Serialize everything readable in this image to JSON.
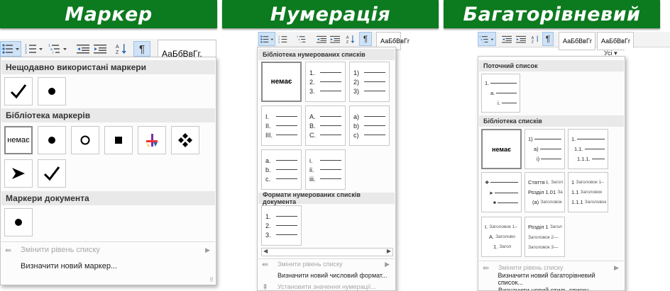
{
  "headers": {
    "marker": "Маркер",
    "numbering": "Нумерація",
    "multilevel": "Багаторівневий"
  },
  "ribbon": {
    "style_sample": "АаБбВвГг,",
    "style_sample_small": "АаБбВвГг",
    "pilcrow": "¶",
    "sort": "A↓Z",
    "all_label": "Усі ▾"
  },
  "bullets": {
    "recent_title": "Нещодавно використані маркери",
    "library_title": "Бібліотека маркерів",
    "document_title": "Маркери документа",
    "none_label": "немає",
    "change_level": "Змінити рівень списку",
    "define_new": "Визначити новий маркер..."
  },
  "numbering": {
    "library_title": "Бібліотека нумерованих списків",
    "document_title": "Формати нумерованих списків документа",
    "none_label": "немає",
    "sets": [
      [
        "1.",
        "2.",
        "3."
      ],
      [
        "1)",
        "2)",
        "3)"
      ],
      [
        "I.",
        "II.",
        "III."
      ],
      [
        "A.",
        "B.",
        "C."
      ],
      [
        "a)",
        "b)",
        "c)"
      ],
      [
        "a.",
        "b.",
        "c."
      ],
      [
        "i.",
        "ii.",
        "iii."
      ]
    ],
    "doc_set": [
      "1.",
      "2.",
      "3."
    ],
    "change_level": "Змінити рівень списку",
    "define_new": "Визначити новий числовий формат...",
    "set_value": "Установити значення нумерації..."
  },
  "multilevel": {
    "current_title": "Поточний список",
    "library_title": "Бібліотека списків",
    "none_label": "немає",
    "current": [
      "1.",
      "a.",
      "i."
    ],
    "lib1": [
      "1)",
      "a)",
      "i)"
    ],
    "lib2": [
      "1.",
      "1.1.",
      "1.1.1."
    ],
    "lib4a": "Стаття I.",
    "lib4a_g": "Загол",
    "lib4b": "Розділ 1.01",
    "lib4b_g": "За",
    "lib4c": "(a)",
    "lib4c_g": "Заголовок",
    "lib5a": "1",
    "lib5a_g": "Заголовок 1–",
    "lib5b": "1.1",
    "lib5b_g": "Заголовок",
    "lib5c": "1.1.1",
    "lib5c_g": "Заголовок",
    "lib6a": "I.",
    "lib6a_g": "Заголовок 1–",
    "lib6b": "A.",
    "lib6b_g": "Заголово",
    "lib6c": "1.",
    "lib6c_g": "Загол",
    "lib7a": "Розділ 1",
    "lib7a_g": "Загол",
    "lib7b_g": "Заголовок 2—",
    "lib7c_g": "Заголовок 3—",
    "change_level": "Змінити рівень списку",
    "define_new": "Визначити новий багаторівневий список...",
    "define_style": "Визначити новий стиль списку..."
  }
}
